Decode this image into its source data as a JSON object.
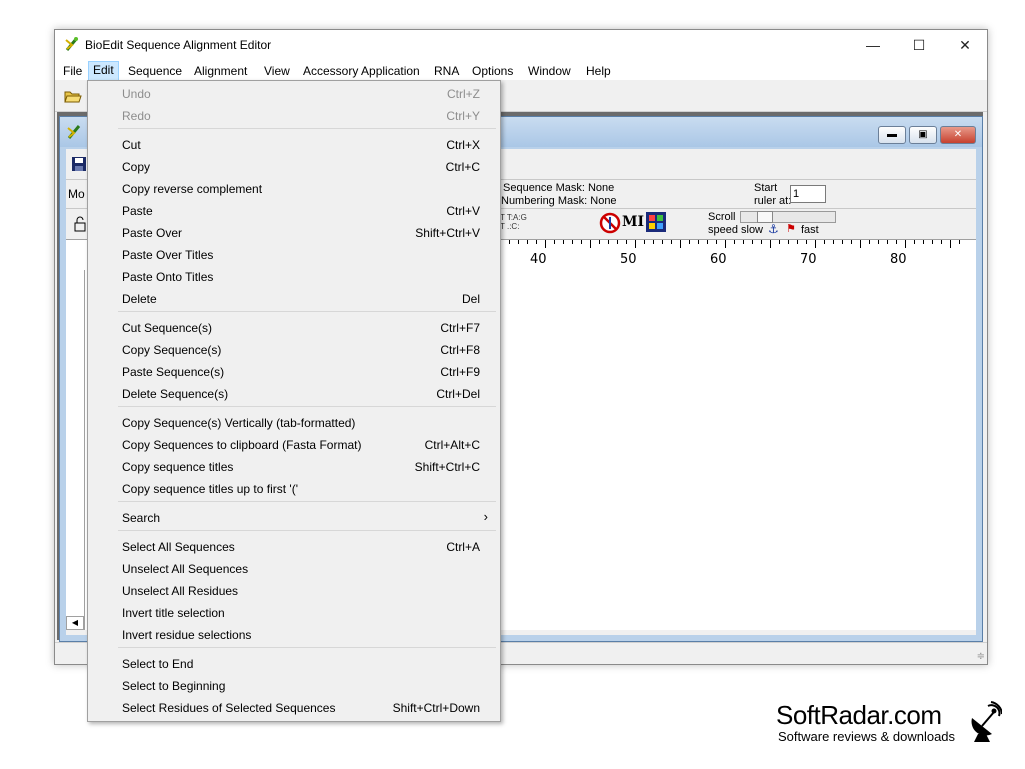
{
  "window": {
    "title": "BioEdit Sequence Alignment Editor"
  },
  "menubar": [
    "File",
    "Edit",
    "Sequence",
    "Alignment",
    "View",
    "Accessory Application",
    "RNA",
    "Options",
    "Window",
    "Help"
  ],
  "child": {
    "partial_left": "Mo",
    "sequence_mask": "Sequence Mask: None",
    "numbering_mask": "Numbering Mask: None",
    "start_label_1": "Start",
    "start_label_2": "ruler at:",
    "start_value": "1",
    "scroll_label": "Scroll",
    "speed_label": "speed",
    "slow_label": "slow",
    "fast_label": "fast",
    "mi_label": "MI",
    "ruler_ticks": [
      "40",
      "50",
      "60",
      "70",
      "80"
    ]
  },
  "edit_menu": {
    "items": [
      {
        "label": "Undo",
        "shortcut": "Ctrl+Z",
        "disabled": true
      },
      {
        "label": "Redo",
        "shortcut": "Ctrl+Y",
        "disabled": true
      },
      {
        "label": "Cut",
        "shortcut": "Ctrl+X"
      },
      {
        "label": "Copy",
        "shortcut": "Ctrl+C"
      },
      {
        "label": "Copy reverse complement",
        "shortcut": ""
      },
      {
        "label": "Paste",
        "shortcut": "Ctrl+V"
      },
      {
        "label": "Paste Over",
        "shortcut": "Shift+Ctrl+V"
      },
      {
        "label": "Paste Over Titles",
        "shortcut": ""
      },
      {
        "label": "Paste Onto Titles",
        "shortcut": ""
      },
      {
        "label": "Delete",
        "shortcut": "Del"
      },
      {
        "label": "Cut Sequence(s)",
        "shortcut": "Ctrl+F7"
      },
      {
        "label": "Copy Sequence(s)",
        "shortcut": "Ctrl+F8"
      },
      {
        "label": "Paste Sequence(s)",
        "shortcut": "Ctrl+F9"
      },
      {
        "label": "Delete Sequence(s)",
        "shortcut": "Ctrl+Del"
      },
      {
        "label": "Copy Sequence(s) Vertically (tab-formatted)",
        "shortcut": ""
      },
      {
        "label": "Copy Sequences to clipboard (Fasta Format)",
        "shortcut": "Ctrl+Alt+C"
      },
      {
        "label": "Copy sequence titles",
        "shortcut": "Shift+Ctrl+C"
      },
      {
        "label": "Copy sequence titles up to first '('",
        "shortcut": ""
      },
      {
        "label": "Search",
        "shortcut": "",
        "submenu": true
      },
      {
        "label": "Select All Sequences",
        "shortcut": "Ctrl+A"
      },
      {
        "label": "Unselect All Sequences",
        "shortcut": ""
      },
      {
        "label": "Unselect All Residues",
        "shortcut": ""
      },
      {
        "label": "Invert title selection",
        "shortcut": ""
      },
      {
        "label": "Invert residue selections",
        "shortcut": ""
      },
      {
        "label": "Select to End",
        "shortcut": ""
      },
      {
        "label": "Select to Beginning",
        "shortcut": ""
      },
      {
        "label": "Select Residues of Selected Sequences",
        "shortcut": "Shift+Ctrl+Down"
      }
    ]
  },
  "watermark": {
    "brand": "SoftRadar.com",
    "tagline": "Software reviews & downloads"
  }
}
